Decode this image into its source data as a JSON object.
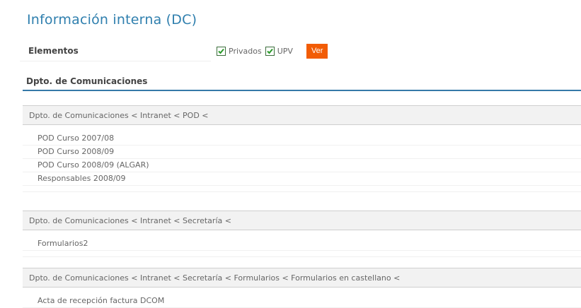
{
  "title": "Información interna (DC)",
  "filter": {
    "label": "Elementos",
    "options": [
      {
        "label": "Privados",
        "checked": true
      },
      {
        "label": "UPV",
        "checked": true
      }
    ],
    "button": "Ver"
  },
  "department": "Dpto. de Comunicaciones",
  "sections": [
    {
      "breadcrumb": "Dpto. de Comunicaciones < Intranet < POD <",
      "items": [
        "POD Curso 2007/08",
        "POD Curso 2008/09",
        "POD Curso 2008/09 (ALGAR)",
        "Responsables 2008/09"
      ]
    },
    {
      "breadcrumb": "Dpto. de Comunicaciones < Intranet < Secretaría <",
      "items": [
        "Formularios2"
      ]
    },
    {
      "breadcrumb": "Dpto. de Comunicaciones < Intranet < Secretaría < Formularios < Formularios en castellano <",
      "items": [
        "Acta de recepción factura DCOM"
      ]
    }
  ],
  "colors": {
    "accent": "#2f7fae",
    "button": "#f25c05",
    "rule": "#3579a8"
  }
}
